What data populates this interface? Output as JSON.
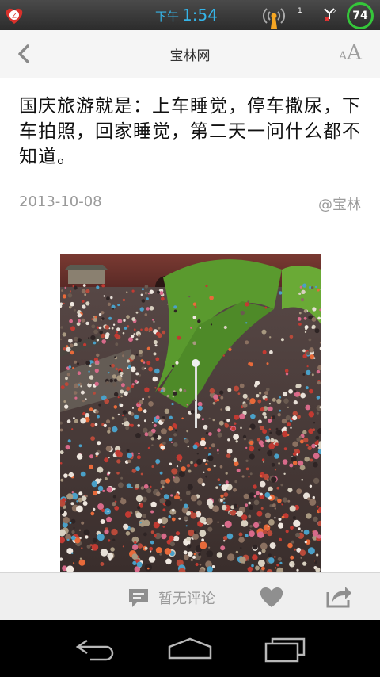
{
  "status_bar": {
    "ampm": "下午",
    "time": "1:54",
    "notification_count": "1",
    "battery_level": "74",
    "icons": [
      "app-shield-icon",
      "signal-tower-icon",
      "data-off-icon",
      "battery-ring-icon"
    ]
  },
  "header": {
    "title": "宝林网",
    "back_icon": "chevron-left-icon",
    "font_size_small": "A",
    "font_size_big": "A"
  },
  "article": {
    "text": "国庆旅游就是：上车睡觉，停车撒尿，下车拍照，回家睡觉，第二天一问什么都不知道。",
    "date": "2013-10-08",
    "author": "@宝林"
  },
  "action_bar": {
    "comment_label": "暂无评论",
    "icons": [
      "comment-icon",
      "heart-icon",
      "share-icon"
    ]
  },
  "colors": {
    "accent_blue": "#35b4e8",
    "battery_green": "#35c63a",
    "text_gray": "#9a9a9a"
  }
}
